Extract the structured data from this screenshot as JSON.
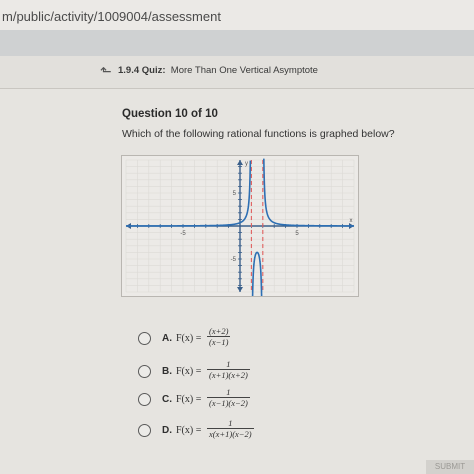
{
  "browser": {
    "url": "m/public/activity/1009004/assessment"
  },
  "quiz": {
    "bold": "1.9.4 Quiz:",
    "title": "More Than One Vertical Asymptote"
  },
  "question": {
    "heading": "Question 10 of 10",
    "prompt": "Which of the following rational functions is graphed below?"
  },
  "graph": {
    "x_tick_labels": [
      "-5",
      "5"
    ],
    "y_tick_labels": [
      "5",
      "-5"
    ],
    "x_axis_label": "x",
    "y_axis_label": "y",
    "x_range": [
      -10,
      10
    ],
    "y_range": [
      -10,
      10
    ],
    "asymptotes_x": [
      1,
      2
    ],
    "asymptote_color": "#e0605f",
    "curve_color": "#2d6fb3"
  },
  "choices": [
    {
      "letter": "A.",
      "fx": "F(x) =",
      "num": "(x+2)",
      "den": "(x−1)"
    },
    {
      "letter": "B.",
      "fx": "F(x) =",
      "num": "1",
      "den": "(x+1)(x+2)"
    },
    {
      "letter": "C.",
      "fx": "F(x) =",
      "num": "1",
      "den": "(x−1)(x−2)"
    },
    {
      "letter": "D.",
      "fx": "F(x) =",
      "num": "1",
      "den": "x(x+1)(x−2)"
    }
  ],
  "submit_label": "SUBMIT"
}
